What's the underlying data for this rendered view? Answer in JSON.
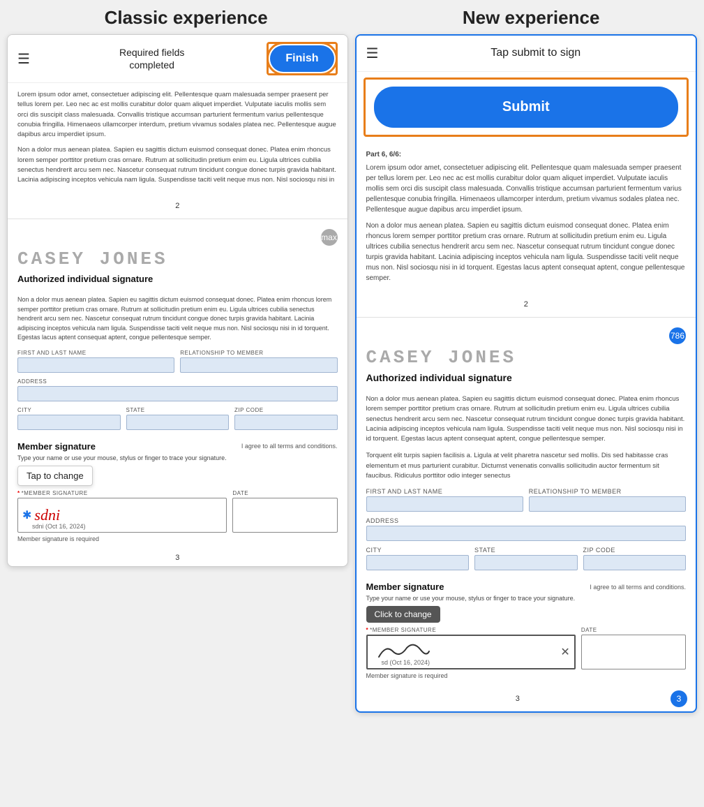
{
  "titles": {
    "classic": "Classic experience",
    "new": "New experience"
  },
  "classic": {
    "header": {
      "hamburger": "☰",
      "title_line1": "Required fields",
      "title_line2": "completed",
      "finish_label": "Finish"
    },
    "lorem1": "Lorem ipsum odor amet, consectetuer adipiscing elit. Pellentesque quam malesuada semper praesent per tellus lorem per. Leo nec ac est mollis curabitur dolor quam aliquet imperdiet. Vulputate iaculis mollis sem orci dis suscipit class malesuada. Convallis tristique accumsan parturient fermentum varius pellentesque conubia fringilla. Himenaeos ullamcorper interdum, pretium vivamus sodales platea nec. Pellentesque augue dapibus arcu imperdiet ipsum.",
    "lorem2": "Non a dolor mus aenean platea. Sapien eu sagittis dictum euismod consequat donec. Platea enim rhoncus lorem semper porttitor pretium cras ornare. Rutrum at sollicitudin pretium enim eu. Ligula ultrices cubilia senectus hendrerit arcu sem nec. Nascetur consequat rutrum tincidunt congue donec turpis gravida habitant. Lacinia adipiscing inceptos vehicula nam ligula. Suspendisse taciti velit neque mus non. Nisl sociosqu nisi in",
    "page2": "2",
    "casey_jones": "CASEY JONES",
    "auth_sig_title": "Authorized individual signature",
    "sig_lorem": "Non a dolor mus aenean platea. Sapien eu sagittis dictum euismod consequat donec. Platea enim rhoncus lorem semper porttitor pretium cras ornare. Rutrum at sollicitudin pretium enim eu. Ligula ultrices cubilia senectus hendrerit arcu sem nec. Nascetur consequat rutrum tincidunt congue donec turpis gravida habitant. Lacinia adipiscing inceptos vehicula nam ligula. Suspendisse taciti velit neque mus non. Nisl sociosqu nisi in id torquent. Egestas lacus aptent consequat aptent, congue pellentesque semper.",
    "field_labels": {
      "first_last": "FIRST AND LAST NAME",
      "relationship": "RELATIONSHIP TO MEMBER",
      "address": "ADDRESS",
      "city": "CITY",
      "state": "STATE",
      "zip": "ZIP CODE"
    },
    "member_sig": {
      "title": "Member signature",
      "terms": "I agree to all terms and conditions.",
      "type_note": "Type your name or use your mouse, stylus or finger to trace your signature.",
      "tap_tooltip": "Tap to change",
      "sig_label": "*MEMBER SIGNATURE",
      "sig_value": "sdni",
      "sig_star": "✱",
      "sig_date": "sdni  (Oct 16, 2024)",
      "date_label": "DATE",
      "required_msg": "Member signature is required"
    },
    "page3": "3"
  },
  "new": {
    "header": {
      "hamburger": "☰",
      "title": "Tap submit to sign"
    },
    "submit_label": "Submit",
    "lorem_part": "Part 6, 6/6:",
    "lorem1": "Lorem ipsum odor amet, consectetuer adipiscing elit. Pellentesque quam malesuada semper praesent per tellus lorem per. Leo nec ac est mollis curabitur dolor quam aliquet imperdiet. Vulputate iaculis mollis sem orci dis suscipit class malesuada. Convallis tristique accumsan parturient fermentum varius pellentesque conubia fringilla. Himenaeos ullamcorper interdum, pretium vivamus sodales platea nec. Pellentesque augue dapibus arcu imperdiet ipsum.",
    "lorem2": "Non a dolor mus aenean platea. Sapien eu sagittis dictum euismod consequat donec. Platea enim rhoncus lorem semper porttitor pretium cras ornare. Rutrum at sollicitudin pretium enim eu. Ligula ultrices cubilia senectus hendrerit arcu sem nec. Nascetur consequat rutrum tincidunt congue donec turpis gravida habitant. Lacinia adipiscing inceptos vehicula nam ligula. Suspendisse taciti velit neque mus non. Nisl sociosqu nisi in id torquent. Egestas lacus aptent consequat aptent, congue pellentesque semper.",
    "page2": "2",
    "casey_jones": "CASEY JONES",
    "auth_sig_title": "Authorized individual signature",
    "sig_lorem1": "Non a dolor mus aenean platea. Sapien eu sagittis dictum euismod consequat donec. Platea enim rhoncus lorem semper porttitor pretium cras ornare. Rutrum at sollicitudin pretium enim eu. Ligula ultrices cubilia senectus hendrerit arcu sem nec. Nascetur consequat rutrum tincidunt congue donec turpis gravida habitant. Lacinia adipiscing inceptos vehicula nam ligula. Suspendisse taciti velit neque mus non. Nisl sociosqu nisi in id torquent. Egestas lacus aptent consequat aptent, congue pellentesque semper.",
    "sig_lorem2": "Torquent elit turpis sapien facilisis a. Ligula at velit pharetra nascetur sed mollis. Dis sed habitasse cras elementum et mus parturient curabitur. Dictumst venenatis convallis sollicitudin auctor fermentum sit faucibus. Ridiculus porttitor odio integer senectus",
    "field_labels": {
      "first_last": "FIRST AND LAST NAME",
      "relationship": "RELATIONSHIP TO MEMBER",
      "address": "ADDRESS",
      "city": "CITY",
      "state": "STATE",
      "zip": "ZIP CODE"
    },
    "member_sig": {
      "title": "Member signature",
      "terms": "I agree to all terms and conditions.",
      "type_note": "Type your name or use your mouse, stylus or finger to trace your signature.",
      "click_tooltip": "Click to change",
      "sig_label": "*MEMBER SIGNATURE",
      "sig_date": "sd (Oct 16, 2024)",
      "date_label": "DATE",
      "required_msg": "Member signature is required"
    },
    "page3": "3",
    "page_bubble": "3",
    "badge_classic": "max",
    "badge_new": "786"
  }
}
